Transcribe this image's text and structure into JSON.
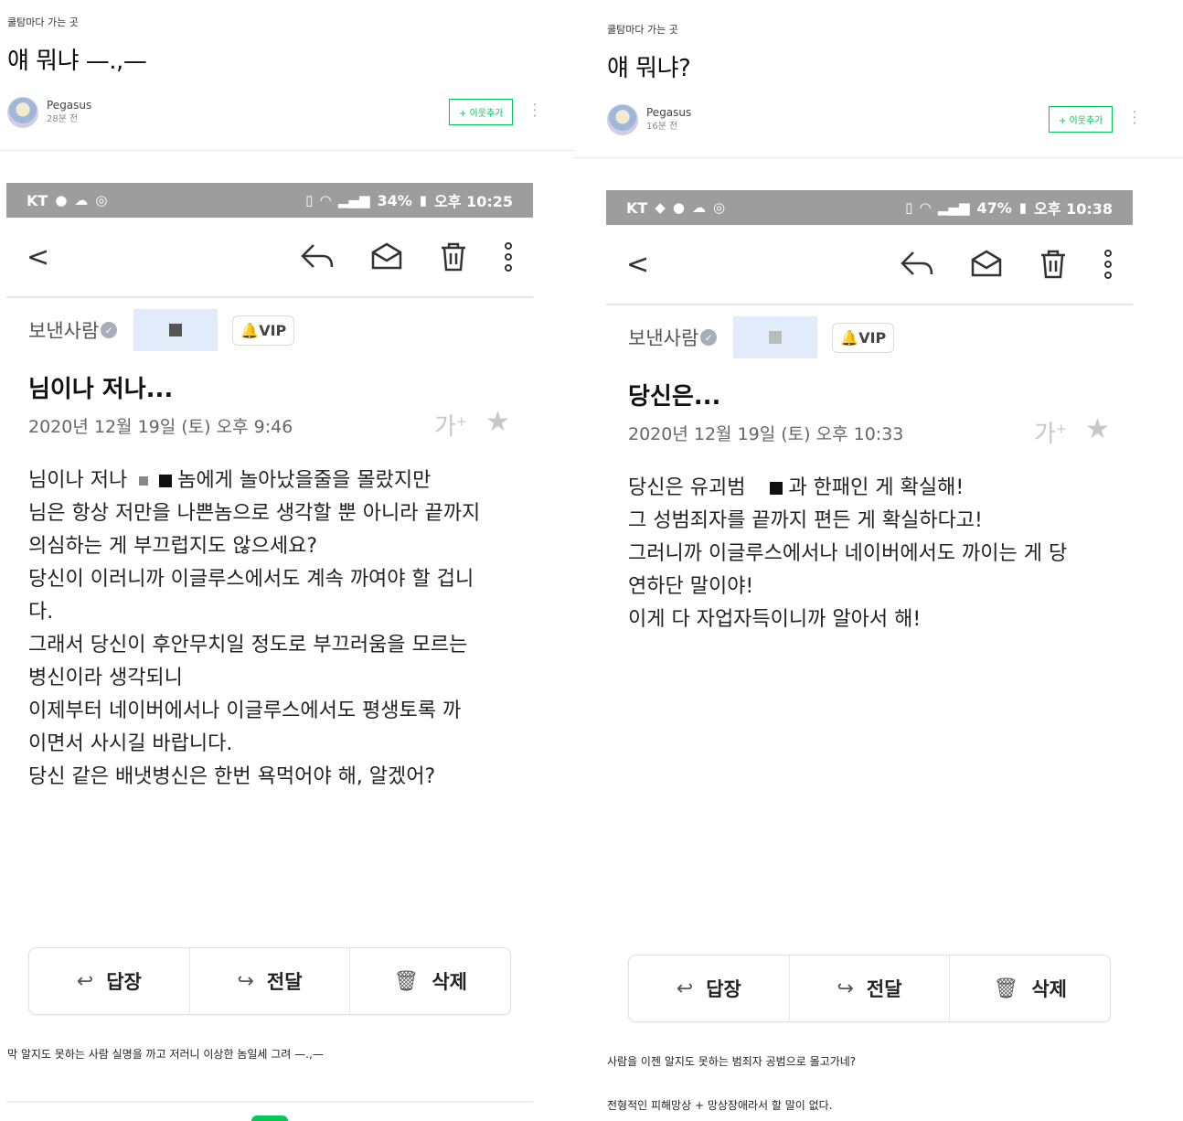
{
  "left": {
    "category": "쿨탐마다 가는 곳",
    "title": "얘 뭐냐 —.,—",
    "author": "Pegasus",
    "time_ago": "28분 전",
    "follow_label": "+ 이웃추가",
    "status": {
      "carrier": "KT",
      "battery": "34%",
      "clock": "오후 10:25"
    },
    "sender_label": "보낸사람",
    "vip_label": "VIP",
    "subject": "님이나 저나...",
    "date": "2020년 12월 19일 (토) 오후 9:46",
    "font_icon": "가",
    "body": {
      "l1a": "님이나 저나",
      "l1b": "놈에게 놀아났을줄을 몰랐지만",
      "l2": "님은 항상 저만을 나쁜놈으로 생각할 뿐 아니라 끝까지",
      "l3": "의심하는 게 부끄럽지도 않으세요?",
      "l4": "당신이 이러니까 이글루스에서도 계속 까여야 할 겁니",
      "l5": "다.",
      "l6": "그래서 당신이 후안무치일 정도로 부끄러움을 모르는",
      "l7": "병신이라 생각되니",
      "l8": "이제부터 네이버에서나 이글루스에서도 평생토록 까",
      "l9": "이면서 사시길 바랍니다.",
      "l10": "당신 같은 배냇병신은 한번 욕먹어야 해, 알겠어?"
    },
    "actions": {
      "reply": "답장",
      "forward": "전달",
      "delete": "삭제"
    },
    "caption": "막 알지도 못하는 사람 실명을 까고 저러니 이상한 놈일세 그려 —.,—"
  },
  "right": {
    "category": "쿨탐마다 가는 곳",
    "title": "얘 뭐냐?",
    "author": "Pegasus",
    "time_ago": "16분 전",
    "follow_label": "+ 이웃추가",
    "status": {
      "carrier": "KT",
      "battery": "47%",
      "clock": "오후 10:38"
    },
    "sender_label": "보낸사람",
    "vip_label": "VIP",
    "subject": "당신은...",
    "date": "2020년 12월 19일 (토) 오후 10:33",
    "font_icon": "가",
    "body": {
      "l1a": "당신은 유괴범",
      "l1b": "과 한패인 게 확실해!",
      "l2": "그 성범죄자를 끝까지 편든 게 확실하다고!",
      "l3": "그러니까 이글루스에서나 네이버에서도 까이는 게 당",
      "l4": "연하단 말이야!",
      "l5": "이게 다 자업자득이니까 알아서 해!"
    },
    "actions": {
      "reply": "답장",
      "forward": "전달",
      "delete": "삭제"
    },
    "caption1": "사람을 이젠 알지도 못하는 범죄자 공범으로 몰고가네?",
    "caption2": "전형적인 피해망상 + 망상장애라서 할 말이 없다."
  },
  "colors": {
    "naver_green": "#03c75a",
    "statusbar_gray": "#9d9d9d"
  }
}
